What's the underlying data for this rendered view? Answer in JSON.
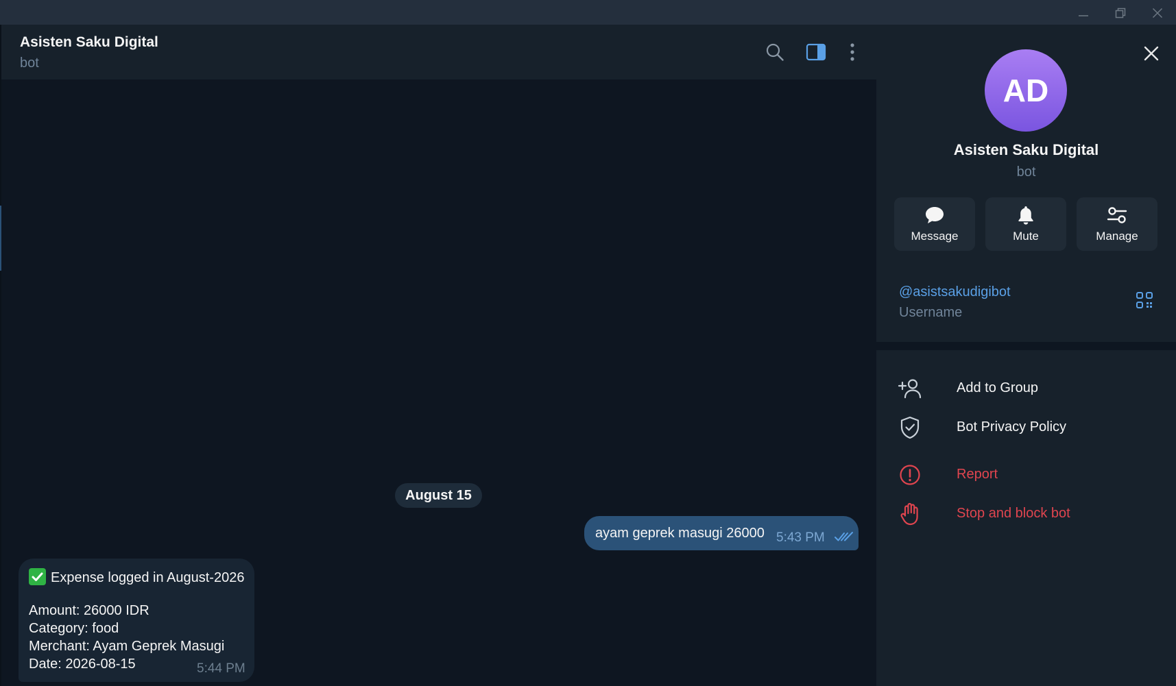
{
  "chat": {
    "title": "Asisten Saku Digital",
    "status": "bot",
    "date_separator": "August 15",
    "outgoing": {
      "text": "ayam geprek masugi 26000",
      "time": "5:43 PM",
      "read_status_icon": "double-check-icon"
    },
    "incoming": {
      "lines": [
        "Expense logged in August-2026",
        "Amount: 26000 IDR",
        "Category: food",
        "Merchant: Ayam Geprek Masugi",
        "Date: 2026-08-15"
      ],
      "emoji_icon": "check-mark-button-icon",
      "time": "5:44 PM"
    }
  },
  "profile": {
    "avatar_initials": "AD",
    "name": "Asisten Saku Digital",
    "status": "bot",
    "actions": [
      {
        "label": "Message",
        "icon": "chat-bubble-icon"
      },
      {
        "label": "Mute",
        "icon": "bell-icon"
      },
      {
        "label": "Manage",
        "icon": "sliders-icon"
      }
    ],
    "username": {
      "value": "@asistsakudigibot",
      "label": "Username"
    },
    "menu": [
      {
        "label": "Add to Group",
        "icon": "add-user-icon",
        "danger": false
      },
      {
        "label": "Bot Privacy Policy",
        "icon": "shield-check-icon",
        "danger": false
      },
      {
        "label": "Report",
        "icon": "alert-circle-icon",
        "danger": true
      },
      {
        "label": "Stop and block bot",
        "icon": "hand-stop-icon",
        "danger": true
      }
    ]
  },
  "colors": {
    "background": "#0e1621",
    "panel": "#17212b",
    "outgoing_bubble": "#2b5278",
    "incoming_bubble": "#182533",
    "accent": "#5aa0e6",
    "danger": "#e0454f",
    "avatar_gradient_top": "#a97ef3",
    "avatar_gradient_bottom": "#7a55e0"
  }
}
